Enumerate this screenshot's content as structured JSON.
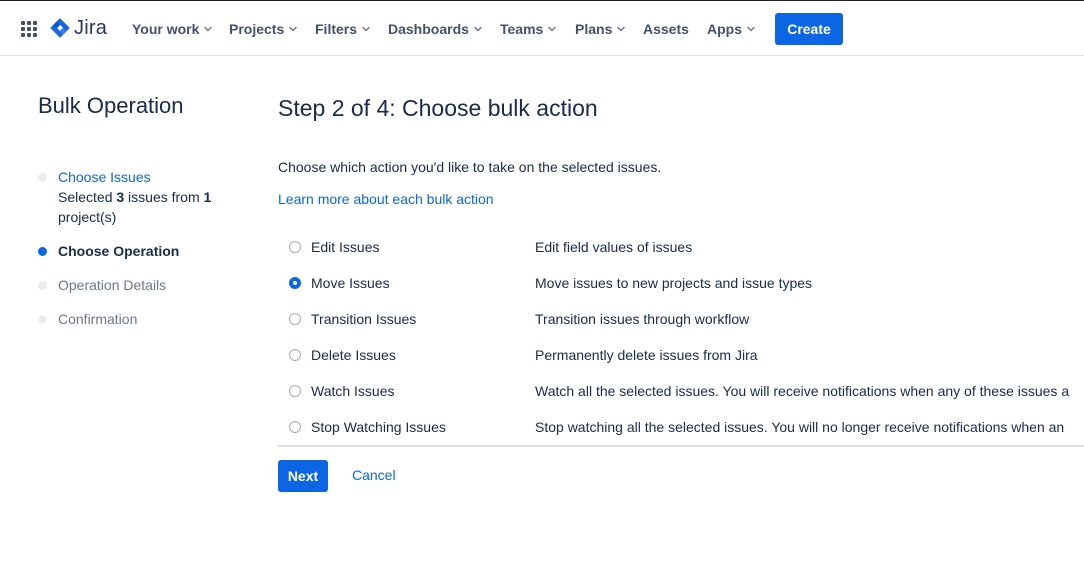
{
  "topnav": {
    "logo_text": "Jira",
    "items": [
      {
        "label": "Your work"
      },
      {
        "label": "Projects"
      },
      {
        "label": "Filters"
      },
      {
        "label": "Dashboards"
      },
      {
        "label": "Teams"
      },
      {
        "label": "Plans"
      },
      {
        "label": "Assets"
      },
      {
        "label": "Apps"
      }
    ],
    "create_label": "Create",
    "icons": {
      "apps": "app-switcher-grid-icon",
      "logo": "jira-logo-icon",
      "chevron": "chevron-down-icon"
    },
    "colors": {
      "brand": "#0c66e4",
      "nav_text": "#42526e"
    }
  },
  "sidebar": {
    "title": "Bulk Operation",
    "steps": [
      {
        "label": "Choose Issues",
        "state": "done",
        "sub_prefix": "Selected ",
        "sub_count": "3",
        "sub_middle": " issues from ",
        "sub_projects": "1",
        "sub_suffix": "project(s)"
      },
      {
        "label": "Choose Operation",
        "state": "current"
      },
      {
        "label": "Operation Details",
        "state": "pending"
      },
      {
        "label": "Confirmation",
        "state": "pending"
      }
    ]
  },
  "main": {
    "title": "Step 2 of 4: Choose bulk action",
    "intro": "Choose which action you'd like to take on the selected issues.",
    "learn_more": "Learn more about each bulk action",
    "options": [
      {
        "label": "Edit Issues",
        "description": "Edit field values of issues",
        "selected": false
      },
      {
        "label": "Move Issues",
        "description": "Move issues to new projects and issue types",
        "selected": true
      },
      {
        "label": "Transition Issues",
        "description": "Transition issues through workflow",
        "selected": false
      },
      {
        "label": "Delete Issues",
        "description": "Permanently delete issues from Jira",
        "selected": false
      },
      {
        "label": "Watch Issues",
        "description": "Watch all the selected issues. You will receive notifications when any of these issues a",
        "selected": false
      },
      {
        "label": "Stop Watching Issues",
        "description": "Stop watching all the selected issues. You will no longer receive notifications when an",
        "selected": false
      }
    ],
    "next_label": "Next",
    "cancel_label": "Cancel"
  }
}
